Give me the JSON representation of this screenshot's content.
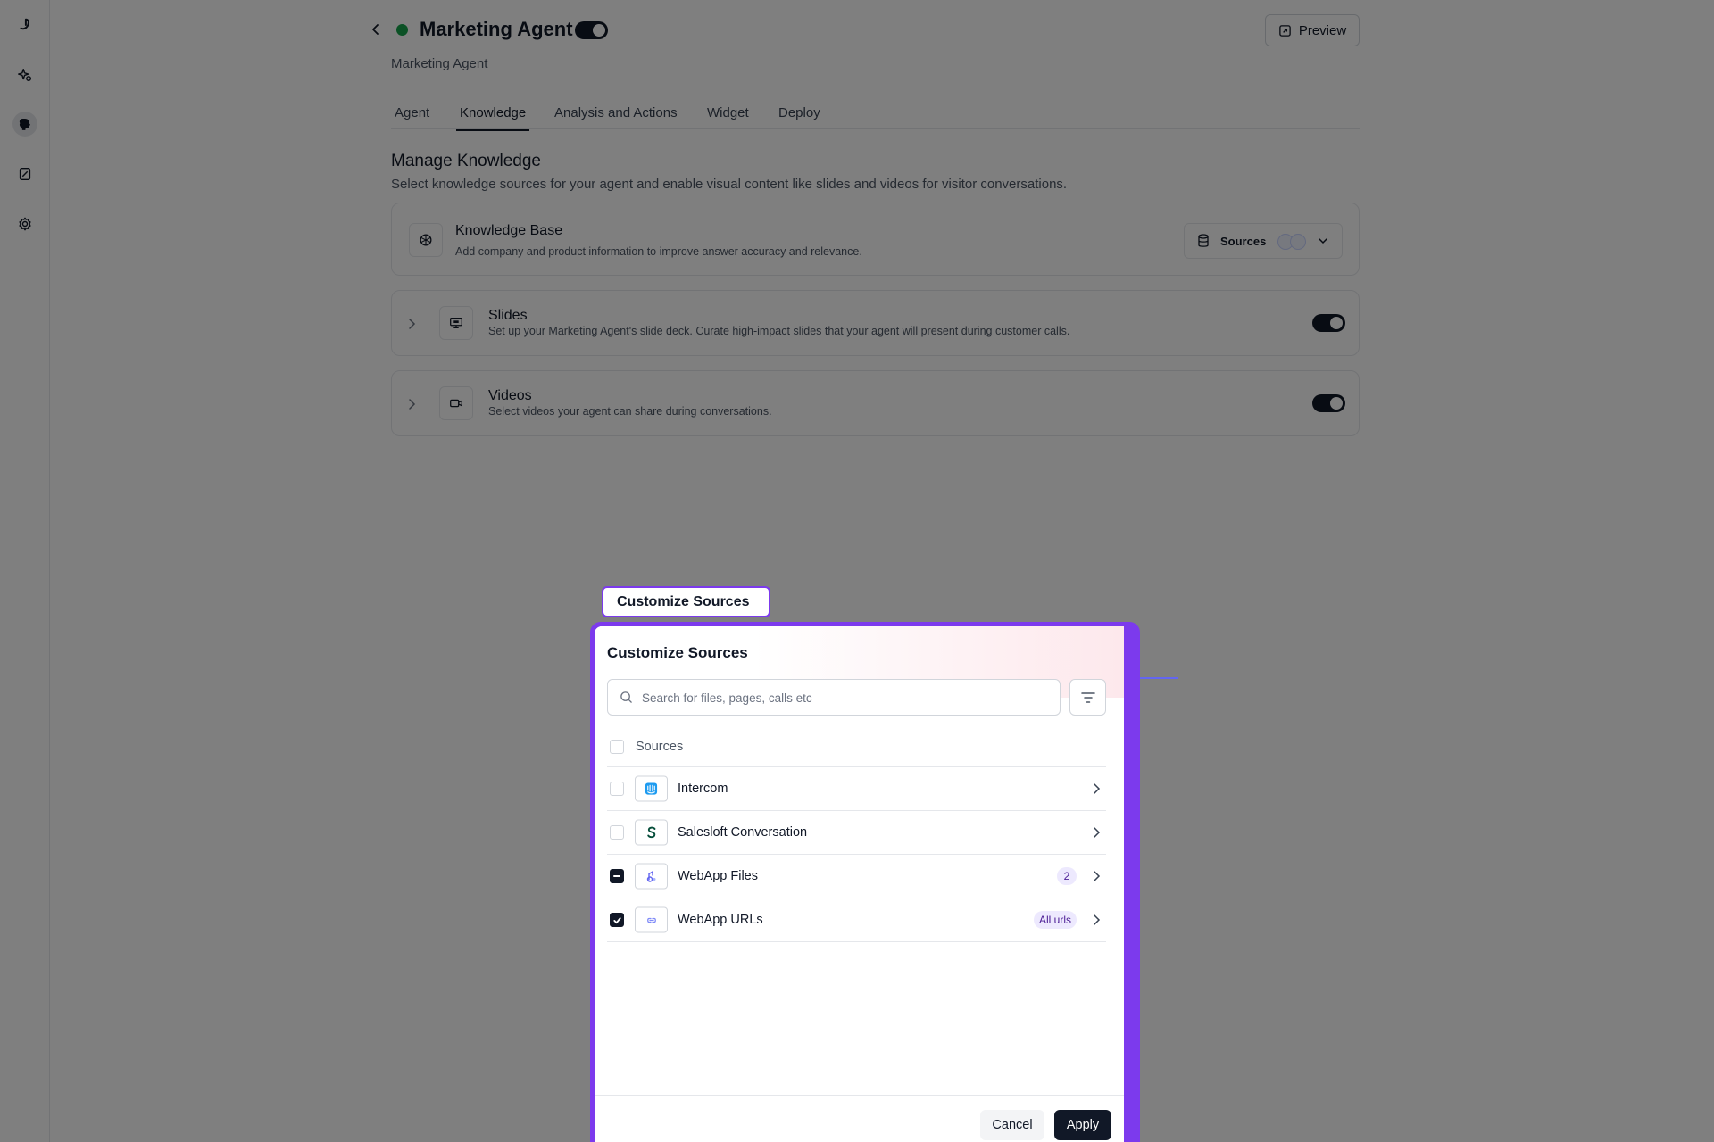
{
  "sidebar": {
    "icons": [
      "app-logo-icon",
      "agent-sparkle-icon",
      "brain-icon",
      "document-icon",
      "gear-icon"
    ]
  },
  "header": {
    "title": "Marketing Agent",
    "subtitle": "Marketing Agent",
    "active": true,
    "preview_label": "Preview",
    "status_color": "#16a34a"
  },
  "tabs": [
    {
      "label": "Agent"
    },
    {
      "label": "Knowledge",
      "active": true
    },
    {
      "label": "Analysis and Actions"
    },
    {
      "label": "Widget"
    },
    {
      "label": "Deploy"
    }
  ],
  "section": {
    "title": "Manage Knowledge",
    "description": "Select knowledge sources for your agent and enable visual content like slides and videos for visitor conversations."
  },
  "cards": {
    "knowledge_base": {
      "title": "Knowledge Base",
      "description": "Add company and product information to improve answer accuracy and relevance.",
      "sources_label": "Sources"
    },
    "slides": {
      "title": "Slides",
      "description": "Set up your Marketing Agent's slide deck. Curate high-impact slides that your agent will present during customer calls.",
      "enabled": true
    },
    "videos": {
      "title": "Videos",
      "description": "Select videos your agent can share during conversations.",
      "enabled": true
    }
  },
  "annotation": {
    "label": "Customize Sources",
    "color": "#7c3aed"
  },
  "dialog": {
    "title": "Customize Sources",
    "search_placeholder": "Search for files, pages, calls etc",
    "search_value": "",
    "header_label": "Sources",
    "items": [
      {
        "name": "Intercom",
        "icon": "intercom-icon",
        "state": "unchecked",
        "badge": ""
      },
      {
        "name": "Salesloft Conversation",
        "icon": "salesloft-icon",
        "state": "unchecked",
        "badge": ""
      },
      {
        "name": "WebApp Files",
        "icon": "webapp-files-icon",
        "state": "indeterminate",
        "badge": "2"
      },
      {
        "name": "WebApp URLs",
        "icon": "webapp-urls-icon",
        "state": "checked",
        "badge": "All urls"
      }
    ],
    "cancel_label": "Cancel",
    "apply_label": "Apply"
  }
}
